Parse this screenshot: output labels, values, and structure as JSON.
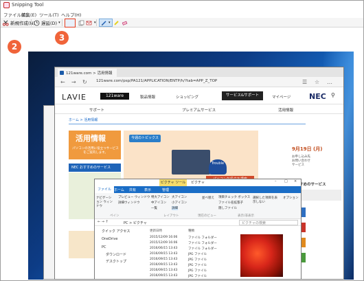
{
  "window": {
    "title": "Snipping Tool"
  },
  "menu": {
    "file": "ファイル(F)",
    "edit": "編集(E)",
    "tools": "ツール(T)",
    "help": "ヘルプ(H)"
  },
  "toolbar": {
    "new_label": "新規作成(N)",
    "delay_label": "遅延(D)"
  },
  "badges": {
    "b2": "2",
    "b3": "3"
  },
  "colors": {
    "badge": "#f0643a",
    "highlight": "#e63b1c",
    "accent": "#1a6dc6"
  },
  "captured": {
    "browser": {
      "tab_title": "121ware.com > 活用情報",
      "url": "121ware.com/psp/PA121/APPLICATION/ENTP/h/?tab=APP_Z_TOP",
      "logo_lavie": "LAVIE",
      "logo_121": "121ware",
      "nav": [
        "製品情報",
        "ショッピング",
        "サービス&サポート",
        "マイページ"
      ],
      "logo_nec": "NEC",
      "subnav": [
        "サポート",
        "プレミアムサービス",
        "活用情報"
      ],
      "breadcrumb": "ホーム > 活用情報",
      "hero_title": "活用情報",
      "hero_sub": "パソコンの活用に役立つサービスをご案内します。",
      "topics": "今週のトピックス",
      "promo": "パソコンお役立ち講座",
      "trouble": "Trouble",
      "nec_service": "NEC おすすめのサービス",
      "date": "9月19日 (月)",
      "side_lines": [
        "お申し込み先",
        "お問い合わせ",
        "サービス"
      ],
      "osusume": "おすすめのサービス",
      "side_more": "サービス"
    },
    "explorer": {
      "tool_tab": "ピクチャ ツール",
      "folder": "ピクチャ",
      "tabs": [
        "ファイル",
        "ホーム",
        "共有",
        "表示",
        "管理"
      ],
      "ribbon": [
        "プレビュー ウィンドウ",
        "詳細ウィンドウ",
        "特大アイコン",
        "大アイコン",
        "一覧",
        "中アイコン",
        "小アイコン",
        "詳細",
        "並べ替え",
        "項目チェック ボックス",
        "ファイル名拡張子",
        "隠しファイル",
        "選択した項目を表示しない",
        "オプション",
        "ナビゲーション ウィンドウ"
      ],
      "groups": [
        "ペイン",
        "レイアウト",
        "現在のビュー",
        "表示/非表示"
      ],
      "address": "PC > ピクチャ",
      "search": "ピクチャの検索",
      "tree": [
        "クイック アクセス",
        "OneDrive",
        "PC",
        "ダウンロード",
        "デスクトップ"
      ],
      "columns": [
        "更新日時",
        "種類"
      ],
      "rows": [
        [
          "2015/12/09 16:06",
          "ファイル フォルダー"
        ],
        [
          "2015/12/09 16:06",
          "ファイル フォルダー"
        ],
        [
          "2016/06/15 13:43",
          "ファイル フォルダー"
        ],
        [
          "2016/09/15 13:43",
          "JPG ファイル"
        ],
        [
          "2016/09/15 13:43",
          "JPG ファイル"
        ],
        [
          "2016/09/15 13:43",
          "JPG ファイル"
        ],
        [
          "2016/09/15 13:43",
          "JPG ファイル"
        ],
        [
          "2016/09/15 13:43",
          "JPG ファイル"
        ]
      ]
    }
  }
}
